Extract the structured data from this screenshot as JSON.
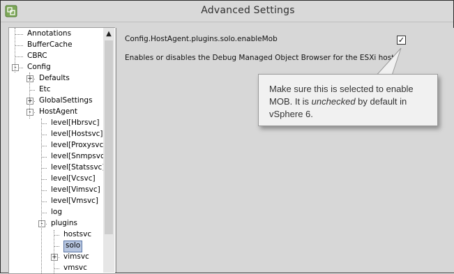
{
  "window": {
    "title": "Advanced Settings",
    "icon": "settings-app-icon"
  },
  "tree": {
    "scroll_up": "▲",
    "items": [
      {
        "label": "Annotations",
        "level": 0,
        "expander": ""
      },
      {
        "label": "BufferCache",
        "level": 0,
        "expander": ""
      },
      {
        "label": "CBRC",
        "level": 0,
        "expander": ""
      },
      {
        "label": "Config",
        "level": 0,
        "expander": "-"
      },
      {
        "label": "Defaults",
        "level": 1,
        "expander": "+"
      },
      {
        "label": "Etc",
        "level": 1,
        "expander": ""
      },
      {
        "label": "GlobalSettings",
        "level": 1,
        "expander": "+"
      },
      {
        "label": "HostAgent",
        "level": 1,
        "expander": "-"
      },
      {
        "label": "level[Hbrsvc]",
        "level": 2,
        "expander": ""
      },
      {
        "label": "level[Hostsvc]",
        "level": 2,
        "expander": ""
      },
      {
        "label": "level[Proxysvc",
        "level": 2,
        "expander": ""
      },
      {
        "label": "level[Snmpsvc",
        "level": 2,
        "expander": ""
      },
      {
        "label": "level[Statssvc]",
        "level": 2,
        "expander": ""
      },
      {
        "label": "level[Vcsvc]",
        "level": 2,
        "expander": ""
      },
      {
        "label": "level[Vimsvc]",
        "level": 2,
        "expander": ""
      },
      {
        "label": "level[Vmsvc]",
        "level": 2,
        "expander": ""
      },
      {
        "label": "log",
        "level": 2,
        "expander": ""
      },
      {
        "label": "plugins",
        "level": 2,
        "expander": "-"
      },
      {
        "label": "hostsvc",
        "level": 3,
        "expander": ""
      },
      {
        "label": "solo",
        "level": 3,
        "expander": "",
        "selected": true
      },
      {
        "label": "vimsvc",
        "level": 3,
        "expander": "+"
      },
      {
        "label": "vmsvc",
        "level": 3,
        "expander": ""
      }
    ]
  },
  "setting": {
    "key": "Config.HostAgent.plugins.solo.enableMob",
    "description": "Enables or disables the Debug Managed Object Browser for the ESXi host.",
    "checked": true,
    "check_glyph": "✓"
  },
  "callout": {
    "text_before": "Make sure this is selected to enable MOB. It is ",
    "text_emphasis": "unchecked",
    "text_after": " by default in vSphere 6."
  }
}
